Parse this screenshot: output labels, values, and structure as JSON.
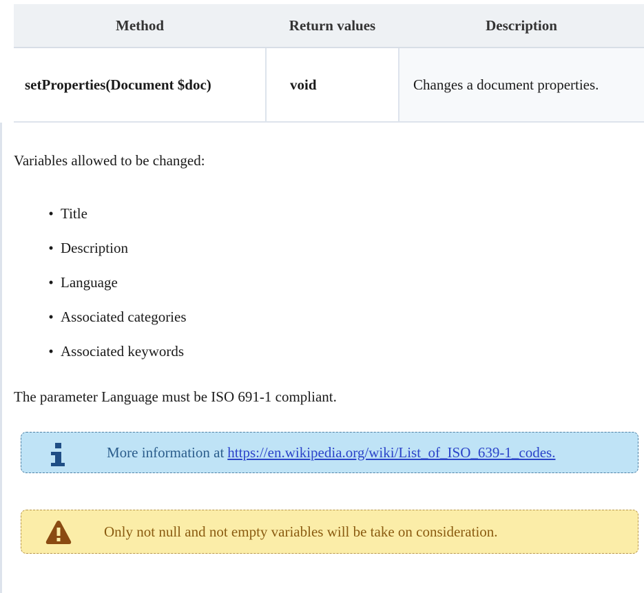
{
  "table": {
    "headers": [
      "Method",
      "Return values",
      "Description"
    ],
    "rows": [
      {
        "method": "setProperties(Document $doc)",
        "return_value": "void",
        "description": "Changes a document properties."
      }
    ]
  },
  "intro": "Variables allowed to be changed:",
  "variables": [
    "Title",
    "Description",
    "Language",
    "Associated categories",
    "Associated keywords"
  ],
  "note": "The parameter Language must be ISO 691-1 compliant.",
  "info_callout": {
    "icon": "info-icon",
    "text": "More information at",
    "link": "https://en.wikipedia.org/wiki/List_of_ISO_639-1_codes.",
    "accent": "#bfe3f6"
  },
  "warning_callout": {
    "icon": "warning-icon",
    "text": "Only not null and not empty variables will be take on consideration.",
    "accent": "#fbeda8"
  }
}
